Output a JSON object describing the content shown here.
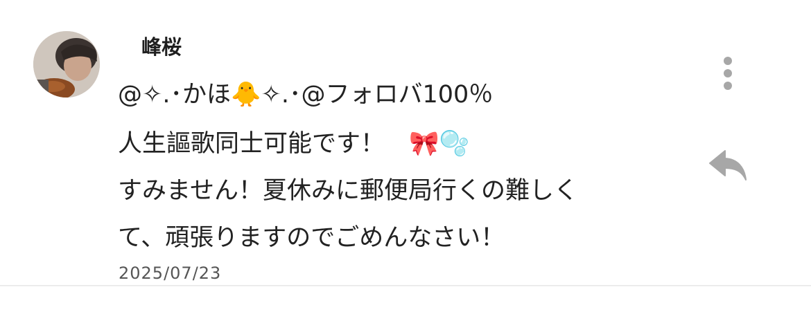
{
  "comment": {
    "username": "峰桜",
    "mention": "@✧.･かほ🐥✧.･@フォロバ100％",
    "lines": [
      "人生謳歌同士可能です！　🎀🫧",
      "すみません！夏休みに郵便局行くの難しく",
      "て、頑張りますのでごめんなさい！"
    ],
    "date": "2025/07/23"
  },
  "icons": {
    "more": "more-vertical-icon",
    "reply": "reply-arrow-icon"
  },
  "colors": {
    "text": "#222222",
    "icon": "#a7a7a7",
    "divider": "#ececec"
  }
}
